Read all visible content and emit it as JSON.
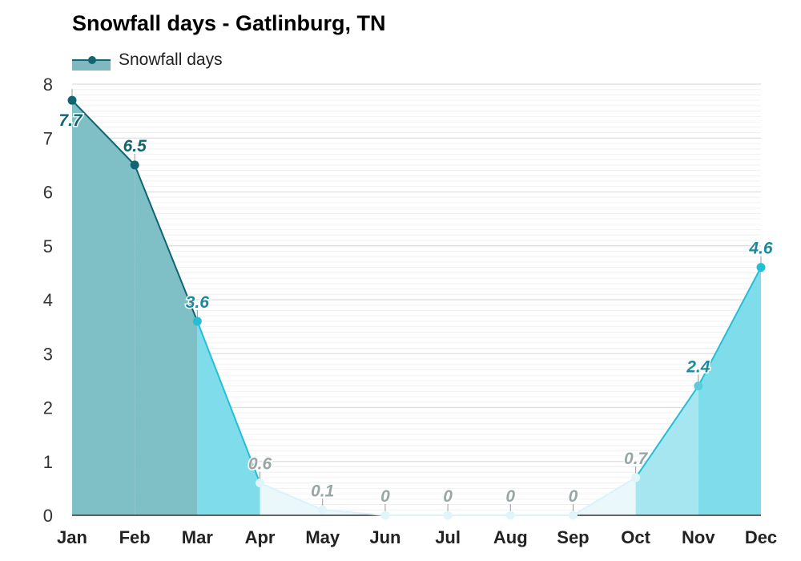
{
  "title": "Snowfall days - Gatlinburg, TN",
  "legend": {
    "label": "Snowfall days",
    "position": "top-left"
  },
  "chart_data": {
    "type": "area",
    "title": "Snowfall days - Gatlinburg, TN",
    "xlabel": "",
    "ylabel": "",
    "categories": [
      "Jan",
      "Feb",
      "Mar",
      "Apr",
      "May",
      "Jun",
      "Jul",
      "Aug",
      "Sep",
      "Oct",
      "Nov",
      "Dec"
    ],
    "series": [
      {
        "name": "Snowfall days",
        "values": [
          7.7,
          6.5,
          3.6,
          0.6,
          0.1,
          0,
          0,
          0,
          0,
          0.7,
          2.4,
          4.6
        ]
      }
    ],
    "data_labels": [
      "7.7",
      "6.5",
      "3.6",
      "0.6",
      "0.1",
      "0",
      "0",
      "0",
      "0",
      "0.7",
      "2.4",
      "4.6"
    ],
    "ylim": [
      0,
      8
    ],
    "yticks": [
      0,
      1,
      2,
      3,
      4,
      5,
      6,
      7,
      8
    ],
    "grid": {
      "major_step": 1,
      "minor_step": 0.1
    },
    "colors": {
      "very_high": "#0f6670",
      "high_fill": "#7fbfc6",
      "medium_fill": "#7fdceb",
      "medium_line": "#22bfd6",
      "low_fill": "#a6e6f1",
      "very_low_fill": "#eaf8fc",
      "very_low_label": "#98a6a6",
      "high_label": "#0f6670",
      "medium_label": "#1b8a9c"
    }
  }
}
